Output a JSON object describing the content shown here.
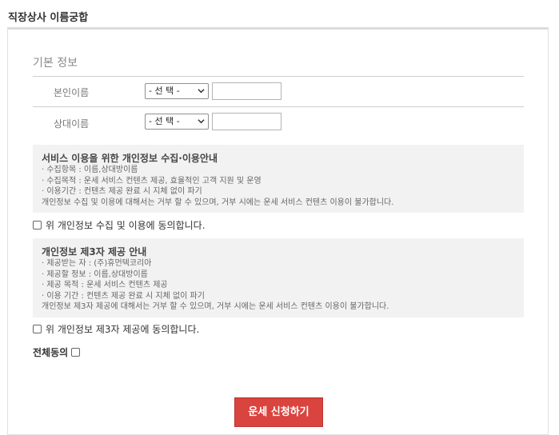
{
  "header": {
    "title": "직장상사 이름궁합"
  },
  "basic_info": {
    "title": "기본 정보",
    "rows": [
      {
        "label": "본인이름",
        "select_value": "- 선 택 -",
        "input_value": ""
      },
      {
        "label": "상대이름",
        "select_value": "- 선 택 -",
        "input_value": ""
      }
    ]
  },
  "privacy_notice": {
    "title": "서비스 이용을 위한 개인정보 수집·이용안내",
    "lines": [
      "· 수집항목 : 이름,상대방이름",
      "· 수집목적 : 운세 서비스 컨텐츠 제공, 효율적인 고객 지원 및 운영",
      "· 이용기간 : 컨텐츠 제공 완료 시 지체 없이 파기",
      "개인정보 수집 및 이용에 대해서는 거부 할 수 있으며, 거부 시에는 운세 서비스 컨텐츠 이용이 불가합니다."
    ],
    "agree_label": "위 개인정보 수집 및 이용에 동의합니다."
  },
  "third_party_notice": {
    "title": "개인정보 제3자 제공 안내",
    "lines": [
      "· 제공받는 자 : (주)휴먼텍코리아",
      "· 제공할 정보 : 이름,상대방이름",
      "· 제공 목적 : 운세 서비스 컨텐츠 제공",
      "· 이용 기간 : 컨텐츠 제공 완료 시 지체 없이 파기",
      "개인정보 제3자 제공에 대해서는 거부 할 수 있으며, 거부 시에는 운세 서비스 컨텐츠 이용이 불가합니다."
    ],
    "agree_label": "위 개인정보 제3자 제공에 동의합니다."
  },
  "all_agree": {
    "label": "전체동의"
  },
  "submit": {
    "label": "운세 신청하기"
  }
}
